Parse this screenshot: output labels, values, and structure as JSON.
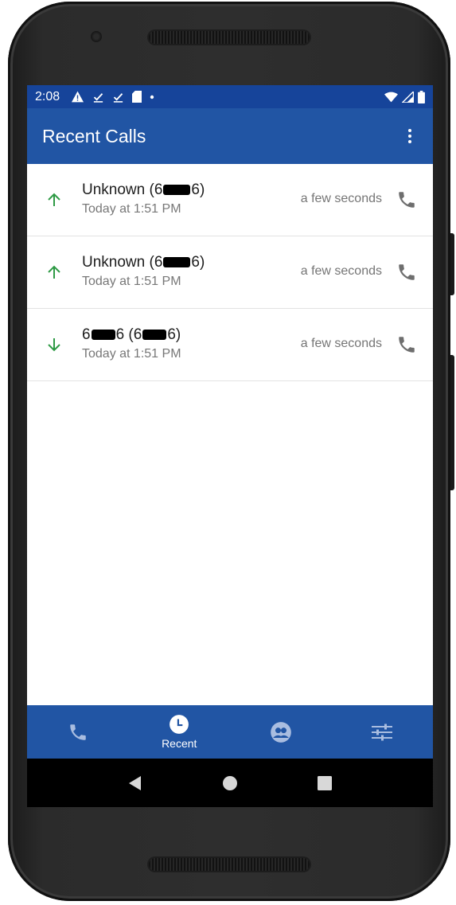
{
  "status_bar": {
    "time": "2:08",
    "icons": [
      "warning-icon",
      "download-done-icon",
      "download-done-icon",
      "sd-card-icon",
      "dot-icon",
      "wifi-icon",
      "signal-icon",
      "battery-icon"
    ]
  },
  "app_bar": {
    "title": "Recent Calls",
    "menu_icon": "more-vert-icon"
  },
  "calls": [
    {
      "direction": "outgoing",
      "name_prefix": "Unknown (6",
      "name_suffix": "6)",
      "name_head": "",
      "name_mid": "",
      "time": "Today at 1:51 PM",
      "duration": "a few seconds"
    },
    {
      "direction": "outgoing",
      "name_prefix": "Unknown (6",
      "name_suffix": "6)",
      "name_head": "",
      "name_mid": "",
      "time": "Today at 1:51 PM",
      "duration": "a few seconds"
    },
    {
      "direction": "incoming",
      "name_head": "6",
      "name_mid": "6 (6",
      "name_suffix": "6)",
      "name_prefix": "",
      "time": "Today at 1:51 PM",
      "duration": "a few seconds"
    }
  ],
  "bottom_nav": {
    "items": [
      {
        "icon": "phone-icon",
        "label": ""
      },
      {
        "icon": "clock-icon",
        "label": "Recent",
        "active": true
      },
      {
        "icon": "contacts-icon",
        "label": ""
      },
      {
        "icon": "settings-sliders-icon",
        "label": ""
      }
    ]
  },
  "colors": {
    "app_bar": "#2155a4",
    "status_bar": "#16449a",
    "arrow": "#2e9a45",
    "call_icon": "#6e6e6e"
  }
}
